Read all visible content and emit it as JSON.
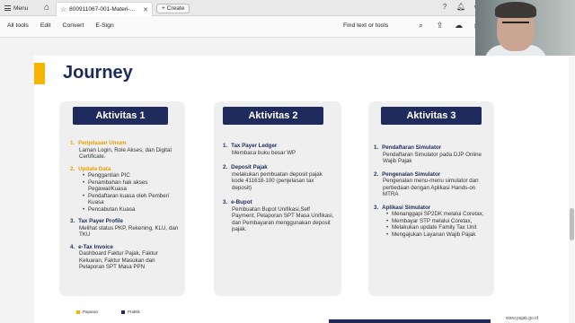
{
  "window": {
    "menu_label": "Menu",
    "tab_title": "800911067-001-Materi-...",
    "create_label": "Create",
    "title_icons": [
      "help-icon",
      "bell-icon",
      "settings-icon"
    ]
  },
  "toolbar": {
    "items": [
      "All tools",
      "Edit",
      "Convert",
      "E-Sign"
    ],
    "find_text": "Find text or tools",
    "icons": [
      "search-icon",
      "upload-icon",
      "cloud-icon",
      "print-icon"
    ]
  },
  "slide": {
    "title": "Journey",
    "accent_color": "#f5b400",
    "header_color": "#1f2b5c",
    "cards": [
      {
        "header": "Aktivitas 1",
        "sections": [
          {
            "num": "1.",
            "title": "Penjelasan Umum",
            "title_color": "orange",
            "sub": "Laman Login, Role Akses, dan Digital Certificate."
          },
          {
            "num": "2.",
            "title": "Update Data",
            "title_color": "orange",
            "bullets": [
              "Penggantian PIC",
              "Penambahan hak akses Pegawai/Kuasa",
              "Pendaftaran kuasa oleh Pemberi Kuasa",
              "Pencabutan Kuasa"
            ]
          },
          {
            "num": "3.",
            "title": "Tax Payer Profile",
            "title_color": "navy",
            "sub": "Melihat status PKP, Rekening, KLU, dan TKU"
          },
          {
            "num": "4.",
            "title": "e-Tax Invoice",
            "title_color": "navy",
            "sub": "Dashboard Faktur Pajak, Faktur Keluaran, Faktur Masukan dan Pelaporan SPT Masa PPN"
          }
        ]
      },
      {
        "header": "Aktivitas 2",
        "sections": [
          {
            "num": "1.",
            "title": "Tax Payer Ledger",
            "title_color": "navy",
            "sub": "Membaca buku besar WP"
          },
          {
            "num": "2.",
            "title": "Deposit Pajak",
            "title_color": "navy",
            "sub": "melakukan pembuatan deposit pajak kode 411618-100 (penjelasan tax deposit)"
          },
          {
            "num": "3.",
            "title": "e-Bupot",
            "title_color": "navy",
            "sub": "Pembuatan Bupot Unifikasi,Self Payment, Pelaporan SPT Masa Unifikasi, dan Pembayaran menggunakan deposit pajak."
          }
        ]
      },
      {
        "header": "Aktivitas 3",
        "sections": [
          {
            "num": "1.",
            "title": "Pendaftaran Simulator",
            "title_color": "navy",
            "sub": "Pendaftaran Simulator pada DJP Online Wajib Pajak"
          },
          {
            "num": "2.",
            "title": "Pengenalan Simulator",
            "title_color": "navy",
            "sub": "Pengenalan menu-menu simulator dan perbedaan dengan Aplikasi Hands-on MTRA"
          },
          {
            "num": "3.",
            "title": "Aplikasi Simulator",
            "title_color": "navy",
            "bullets": [
              "Menanggapi SP2DK melalui Coretax,",
              "Membayar STP melalui Coretax,",
              "Melakukan update Family Tax Unit",
              "Mengajukan Layanan Wajib Pajak"
            ]
          }
        ]
      }
    ],
    "legend": [
      {
        "label": "Paparan",
        "color": "#f5b400"
      },
      {
        "label": "Praktik",
        "color": "#1f2b5c"
      }
    ],
    "footer_link": "www.pajak.go.id"
  }
}
